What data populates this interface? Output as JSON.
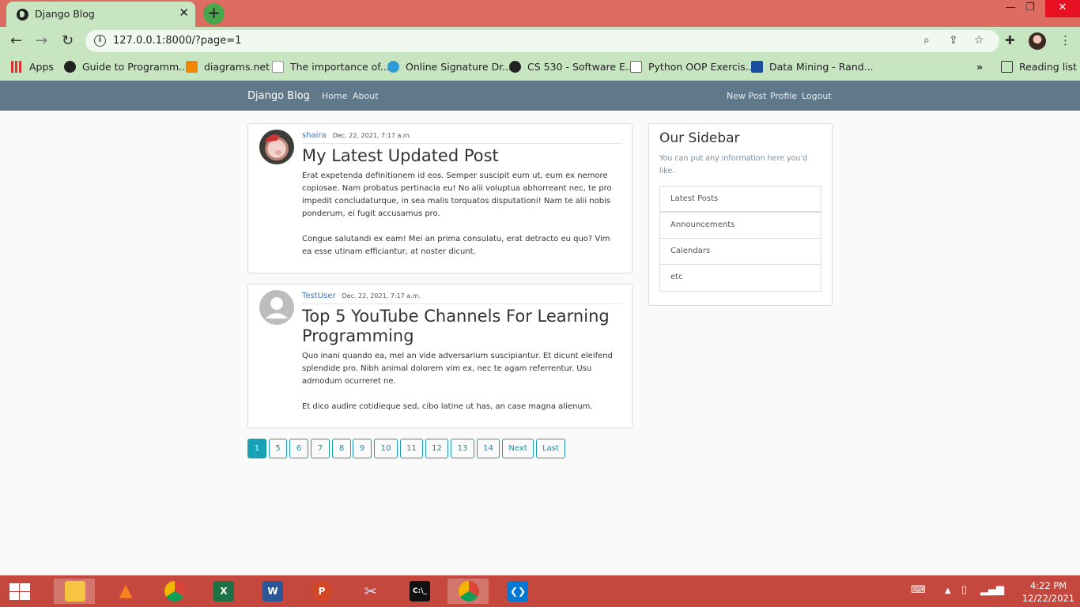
{
  "browser": {
    "tab_title": "Django Blog",
    "url": "127.0.0.1:8000/?page=1",
    "bookmarks": [
      "Apps",
      "Guide to Programm...",
      "diagrams.net",
      "The importance of...",
      "Online Signature Dr...",
      "CS 530 - Software E...",
      "Python OOP Exercis...",
      "Data Mining - Rand..."
    ],
    "reading_list": "Reading list",
    "more_bookmarks": "»"
  },
  "site": {
    "brand": "Django Blog",
    "nav_left": [
      "Home",
      "About"
    ],
    "nav_right": [
      "New Post",
      "Profile",
      "Logout"
    ]
  },
  "posts": [
    {
      "author": "shaira",
      "date": "Dec. 22, 2021, 7:17 a.m.",
      "title": "My Latest Updated Post",
      "paragraphs": [
        "Erat expetenda definitionem id eos. Semper suscipit eum ut, eum ex nemore copiosae. Nam probatus pertinacia eu! No alii voluptua abhorreant nec, te pro impedit concludaturque, in sea malis torquatos disputationi! Nam te alii nobis ponderum, ei fugit accusamus pro.",
        "Congue salutandi ex eam! Mei an prima consulatu, erat detracto eu quo? Vim ea esse utinam efficiantur, at noster dicunt."
      ]
    },
    {
      "author": "TestUser",
      "date": "Dec. 22, 2021, 7:17 a.m.",
      "title": "Top 5 YouTube Channels For Learning Programming",
      "paragraphs": [
        "Quo inani quando ea, mel an vide adversarium suscipiantur. Et dicunt eleifend splendide pro. Nibh animal dolorem vim ex, nec te agam referrentur. Usu admodum ocurreret ne.",
        "Et dico audire cotidieque sed, cibo latine ut has, an case magna alienum."
      ]
    }
  ],
  "sidebar": {
    "title": "Our Sidebar",
    "subtitle": "You can put any information here you'd like.",
    "items": [
      "Latest Posts",
      "Announcements",
      "Calendars",
      "etc"
    ]
  },
  "pagination": {
    "current": "1",
    "pages": [
      "1",
      "5",
      "6",
      "7",
      "8",
      "9",
      "10",
      "11",
      "12",
      "13",
      "14",
      "Next",
      "Last"
    ]
  },
  "taskbar": {
    "time": "4:22 PM",
    "date": "12/22/2021"
  }
}
